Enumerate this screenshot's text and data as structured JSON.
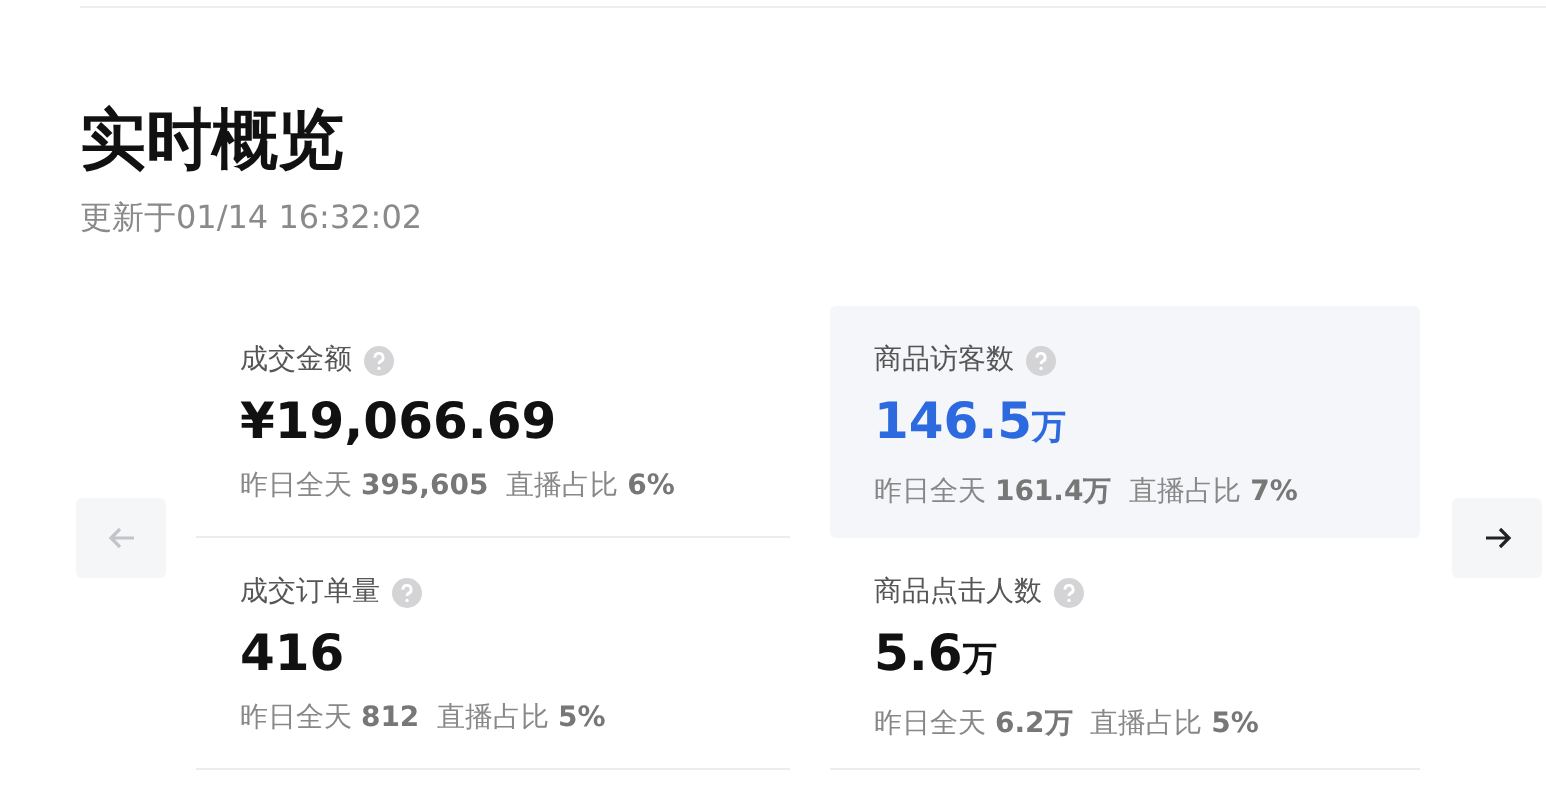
{
  "title": "实时概览",
  "updated": "更新于01/14 16:32:02",
  "nav": {
    "prev_disabled": true,
    "next_disabled": false
  },
  "metrics": [
    {
      "label": "成交金额",
      "value": "¥19,066.69",
      "footer": "昨日全天 **395,605**  直播占比 **6%**",
      "selected": false
    },
    {
      "label": "商品访客数",
      "value": "146.5",
      "unit": "万",
      "footer": "昨日全天 **161.4万**  直播占比 **7%**",
      "selected": true
    },
    {
      "label": "成交订单量",
      "value": "416",
      "footer": "昨日全天 **812**  直播占比 **5%**",
      "selected": false
    },
    {
      "label": "商品点击人数",
      "value": "5.6",
      "unit": "万",
      "footer": "昨日全天 **6.2万**  直播占比 **5%**",
      "selected": false
    }
  ]
}
